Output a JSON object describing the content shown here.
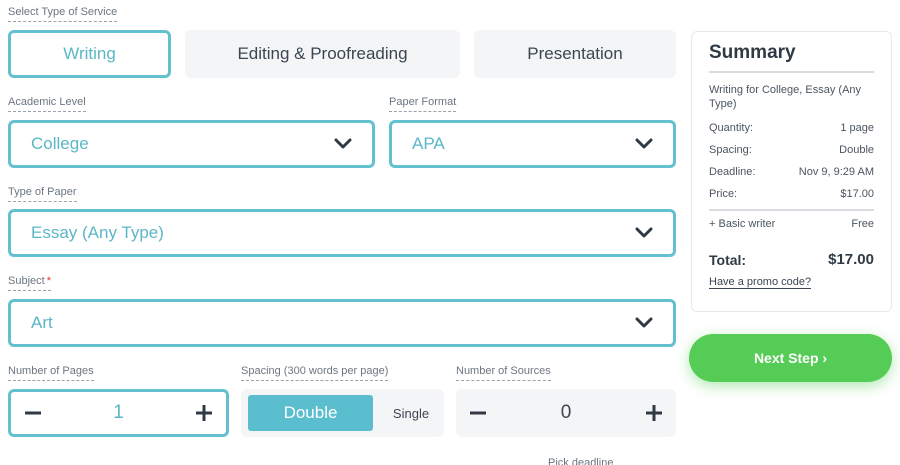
{
  "service": {
    "label": "Select Type of Service",
    "tabs": [
      "Writing",
      "Editing & Proofreading",
      "Presentation"
    ],
    "active": "Writing"
  },
  "academic_level": {
    "label": "Academic Level",
    "value": "College"
  },
  "paper_format": {
    "label": "Paper Format",
    "value": "APA"
  },
  "type_of_paper": {
    "label": "Type of Paper",
    "value": "Essay (Any Type)"
  },
  "subject": {
    "label": "Subject",
    "required_mark": "*",
    "value": "Art"
  },
  "pages": {
    "label": "Number of Pages",
    "value": "1",
    "minus": "−",
    "plus": "+"
  },
  "spacing": {
    "label": "Spacing (300 words per page)",
    "selected": "Double",
    "other": "Single"
  },
  "sources": {
    "label": "Number of Sources",
    "value": "0",
    "minus": "−",
    "plus": "+"
  },
  "summary": {
    "title": "Summary",
    "description": "Writing for College, Essay (Any Type)",
    "rows": [
      {
        "label": "Quantity:",
        "value": "1 page"
      },
      {
        "label": "Spacing:",
        "value": "Double"
      },
      {
        "label": "Deadline:",
        "value": "Nov 9, 9:29 AM"
      },
      {
        "label": "Price:",
        "value": "$17.00"
      }
    ],
    "extra": {
      "label": "+ Basic writer",
      "value": "Free"
    },
    "total_label": "Total:",
    "total_value": "$17.00",
    "promo": "Have a promo code?"
  },
  "next_button": "Next Step ›",
  "cutoff_text": "Pick deadline"
}
